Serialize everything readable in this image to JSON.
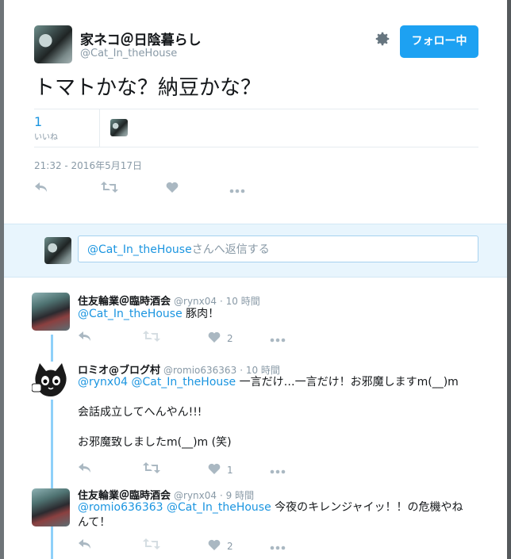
{
  "tweet": {
    "author_name": "家ネコ＠日陰暮らし",
    "author_handle": "@Cat_In_theHouse",
    "follow_label": "フォロー中",
    "text": "トマトかな？納豆かな？",
    "likes_count": "1",
    "likes_label": "いいね",
    "timestamp": "21:32 - 2016年5月17日",
    "icons": [
      "reply-icon",
      "retweet-icon",
      "like-icon",
      "more-icon",
      "gear-icon"
    ]
  },
  "reply_box": {
    "mention": "@Cat_In_theHouse",
    "placeholder_rest": "さんへ返信する"
  },
  "replies": [
    {
      "name": "住友輪業＠臨時酒会",
      "handle": "@rynx04",
      "time": "· 10 時間",
      "mention": "@Cat_In_theHouse",
      "text": " 豚肉！",
      "likes": "2"
    },
    {
      "name": "ロミオ@ブログ村",
      "handle": "@romio636363",
      "time": "· 10 時間",
      "mention": "@rynx04 @Cat_In_theHouse",
      "text": " 一言だけ…一言だけ！お邪魔しますm(__)m",
      "line2": "会話成立してへんやん!!!",
      "line3": "お邪魔致しましたm(__)m (笑)",
      "likes": "1"
    },
    {
      "name": "住友輪業＠臨時酒会",
      "handle": "@rynx04",
      "time": "· 9 時間",
      "mention": "@romio636363 @Cat_In_theHouse",
      "text": " 今夜のキレンジャイッ！！の危機やねんて！",
      "likes": "2"
    }
  ],
  "colors": {
    "accent": "#1da1f2",
    "link": "#1b95e0",
    "muted": "#8899a6",
    "thread_line": "#8ed0f9"
  }
}
